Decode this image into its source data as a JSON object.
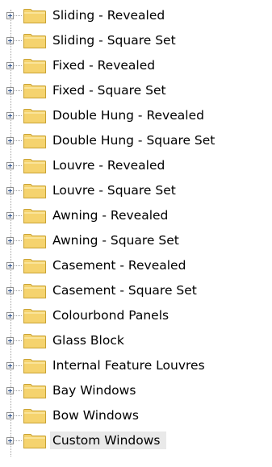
{
  "tree": {
    "items": [
      {
        "label": "Sliding - Revealed"
      },
      {
        "label": "Sliding - Square Set"
      },
      {
        "label": "Fixed - Revealed"
      },
      {
        "label": "Fixed - Square Set"
      },
      {
        "label": "Double Hung - Revealed"
      },
      {
        "label": "Double Hung - Square Set"
      },
      {
        "label": "Louvre - Revealed"
      },
      {
        "label": "Louvre - Square Set"
      },
      {
        "label": "Awning - Revealed"
      },
      {
        "label": "Awning - Square Set"
      },
      {
        "label": "Casement - Revealed"
      },
      {
        "label": "Casement - Square Set"
      },
      {
        "label": "Colourbond Panels"
      },
      {
        "label": "Glass Block"
      },
      {
        "label": "Internal Feature Louvres"
      },
      {
        "label": "Bay Windows"
      },
      {
        "label": "Bow Windows"
      },
      {
        "label": "Custom Windows",
        "selected": true
      }
    ],
    "icons": {
      "expander": "plus-box-icon",
      "folder": "folder-icon"
    },
    "colors": {
      "folder_fill": "#f5d36e",
      "folder_border": "#c9a233",
      "selection": "#e9e9e9",
      "text": "#000000"
    }
  }
}
